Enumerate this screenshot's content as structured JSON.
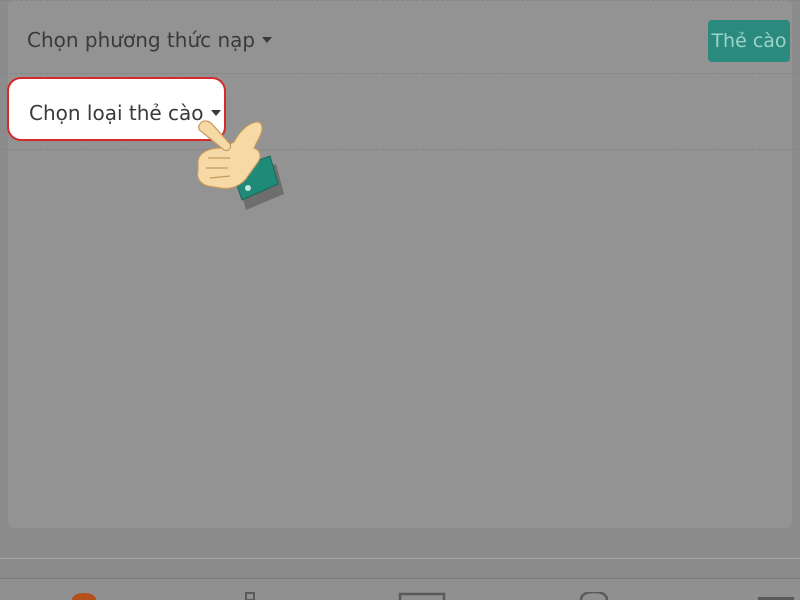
{
  "payment": {
    "method_dropdown_label": "Chọn phương thức nạp",
    "tab_label": "Thẻ cào",
    "card_type_dropdown_label": "Chọn loại thẻ cào"
  },
  "colors": {
    "accent": "#2a8a7d",
    "highlight_border": "#d42a2a",
    "overlay": "#8c8c8c"
  },
  "bottom_nav": {
    "icons": [
      "home-icon",
      "bottle-icon",
      "card-icon",
      "help-icon",
      "menu-icon"
    ]
  }
}
